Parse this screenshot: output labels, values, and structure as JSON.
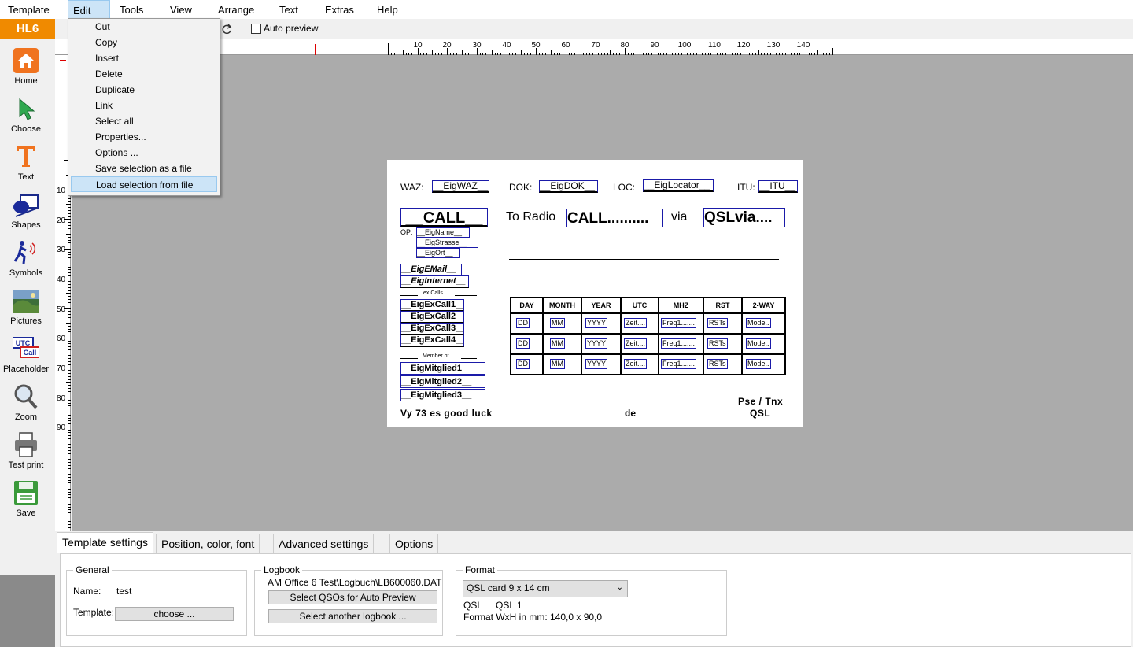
{
  "menubar": {
    "items": [
      "Template",
      "Edit",
      "Tools",
      "View",
      "Arrange",
      "Text",
      "Extras",
      "Help"
    ],
    "active": "Edit"
  },
  "sidebar": {
    "brand": "HL6",
    "items": [
      {
        "label": "Home",
        "icon": "home-icon"
      },
      {
        "label": "Choose",
        "icon": "arrow-cursor-icon"
      },
      {
        "label": "Text",
        "icon": "text-t-icon"
      },
      {
        "label": "Shapes",
        "icon": "shapes-icon"
      },
      {
        "label": "Symbols",
        "icon": "ardf-runner-icon"
      },
      {
        "label": "Pictures",
        "icon": "picture-icon"
      },
      {
        "label": "Placeholder",
        "icon": "utc-call-icon"
      },
      {
        "label": "Zoom",
        "icon": "magnifier-icon"
      },
      {
        "label": "Test print",
        "icon": "printer-icon"
      },
      {
        "label": "Save",
        "icon": "save-icon"
      }
    ]
  },
  "toolbar": {
    "auto_preview": "Auto preview"
  },
  "rulers": {
    "h_ticks": [
      "10",
      "20",
      "30",
      "40",
      "50",
      "60",
      "70",
      "80",
      "90",
      "100",
      "110",
      "120",
      "130",
      "140"
    ],
    "v_ticks": [
      "10",
      "20",
      "30",
      "40",
      "50",
      "60",
      "70",
      "80",
      "90"
    ]
  },
  "edit_menu": {
    "items": [
      "Cut",
      "Copy",
      "Insert",
      "Delete",
      "Duplicate",
      "Link",
      "Select all",
      "Properties...",
      "Options ...",
      "Save selection as a file",
      "Load selection from file"
    ],
    "highlighted": "Load selection from file"
  },
  "card": {
    "waz_label": "WAZ:",
    "waz_field": "__EigWAZ__",
    "dok_label": "DOK:",
    "dok_field": "__EigDOK__",
    "loc_label": "LOC:",
    "loc_field": "__EigLocator__",
    "itu_label": "ITU:",
    "itu_field": "__ITU__",
    "call_field": "__CALL__",
    "to_radio": "To Radio",
    "call_dots": "CALL..........",
    "via": "via",
    "qslvia": "QSLvia....",
    "op_label": "OP:",
    "name_field": "__EigName__",
    "strasse_field": "__EigStrasse__",
    "ort_field": "__EigOrt__",
    "email_field": "__EigEMail__",
    "internet_field": "__EigInternet__",
    "ex_calls_label": "ex Calls",
    "ex_calls": [
      "__EigExCall1__",
      "__EigExCall2__",
      "__EigExCall3__",
      "__EigExCall4__"
    ],
    "member_label": "Member of",
    "members": [
      "__EigMitglied1__",
      "__EigMitglied2__",
      "__EigMitglied3__"
    ],
    "table_headers": [
      "DAY",
      "MONTH",
      "YEAR",
      "UTC",
      "MHZ",
      "RST",
      "2-WAY"
    ],
    "table_row": [
      "DD",
      "MM",
      "YYYY",
      "Zeit....",
      "Freq1.......",
      "RSTs",
      "Mode.."
    ],
    "vy73": "Vy 73 es good luck",
    "de": "de",
    "pse_tnx": "Pse / Tnx",
    "qsl": "QSL"
  },
  "bottom": {
    "tabs": [
      "Template settings",
      "Position, color, font",
      "Advanced settings",
      "Options"
    ],
    "active_tab": "Template settings",
    "general": {
      "title": "General",
      "name_label": "Name:",
      "name_value": "test",
      "template_label": "Template:",
      "choose_button": "choose ..."
    },
    "logbook": {
      "title": "Logbook",
      "path": "AM Office 6 Test\\Logbuch\\LB600060.DAT",
      "select_qsos_button": "Select QSOs for Auto Preview",
      "select_logbook_button": "Select another logbook ..."
    },
    "format": {
      "title": "Format",
      "selected": "QSL card 9 x 14 cm",
      "type_label": "QSL",
      "type_value": "QSL 1",
      "size_label": "Format WxH in mm: 140,0 x 90,0"
    }
  },
  "colors": {
    "brand": "#f08a00",
    "field_border": "#1a1aa8",
    "menu_highlight": "#cce4f7",
    "canvas": "#ababab"
  }
}
